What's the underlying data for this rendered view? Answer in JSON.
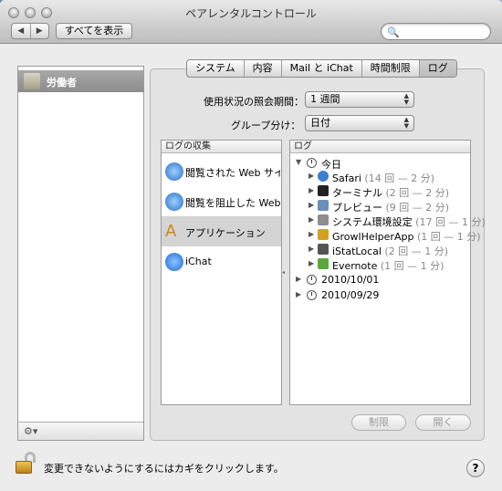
{
  "window": {
    "title": "ペアレンタルコントロール"
  },
  "toolbar": {
    "back": "◀",
    "forward": "▶",
    "show_all": "すべてを表示",
    "search_placeholder": ""
  },
  "sidebar": {
    "user_name": "労働者",
    "gear": "⚙▾"
  },
  "tabs": [
    {
      "label": "システム"
    },
    {
      "label": "内容"
    },
    {
      "label": "Mail と iChat"
    },
    {
      "label": "時間制限"
    },
    {
      "label": "ログ",
      "selected": true
    }
  ],
  "settings": {
    "period_label": "使用状況の照会期間：",
    "period_value": "1 週間",
    "group_label": "グループ分け：",
    "group_value": "日付"
  },
  "collections": {
    "header": "ログの収集",
    "items": [
      {
        "label": "閲覧された Web サイト",
        "icon": "safari-icon"
      },
      {
        "label": "閲覧を阻止した Web サイト",
        "icon": "safari-blocked-icon"
      },
      {
        "label": "アプリケーション",
        "icon": "applications-icon",
        "selected": true
      },
      {
        "label": "iChat",
        "icon": "ichat-icon"
      }
    ]
  },
  "log": {
    "header": "ログ",
    "groups": [
      {
        "label": "今日",
        "expanded": true,
        "apps": [
          {
            "name": "Safari",
            "count": "(14 回 — 2 分)",
            "color": "#3a7fd0"
          },
          {
            "name": "ターミナル",
            "count": "(2 回 — 2 分)",
            "color": "#222222"
          },
          {
            "name": "プレビュー",
            "count": "(9 回 — 2 分)",
            "color": "#6a8fb8"
          },
          {
            "name": "システム環境設定",
            "count": "(17 回 — 1 分)",
            "color": "#8e8e8e"
          },
          {
            "name": "GrowlHelperApp",
            "count": "(1 回 — 1 分)",
            "color": "#d4a020"
          },
          {
            "name": "iStatLocal",
            "count": "(2 回 — 1 分)",
            "color": "#555555"
          },
          {
            "name": "Evernote",
            "count": "(1 回 — 1 分)",
            "color": "#5aa83a"
          }
        ]
      },
      {
        "label": "2010/10/01",
        "expanded": false
      },
      {
        "label": "2010/09/29",
        "expanded": false
      }
    ]
  },
  "buttons": {
    "restrict": "制限",
    "open": "開く"
  },
  "footer": {
    "lock_text": "変更できないようにするにはカギをクリックします。",
    "help": "?"
  }
}
